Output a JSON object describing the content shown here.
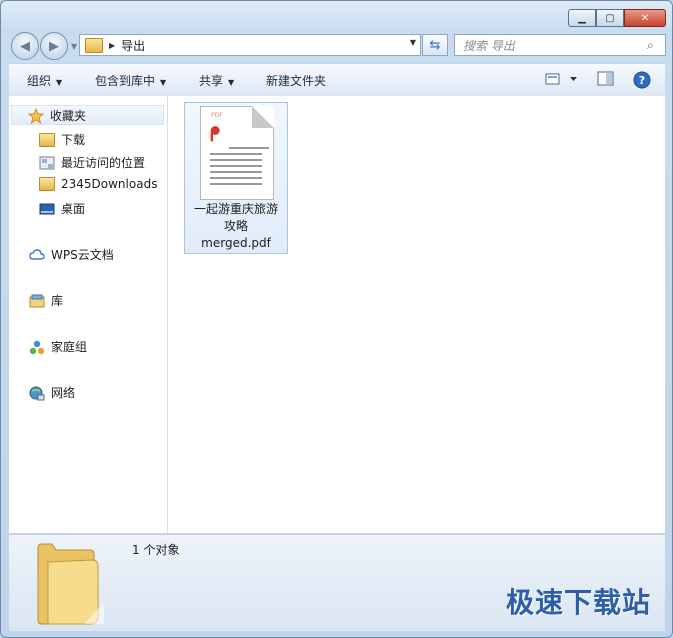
{
  "address": {
    "path": "导出"
  },
  "search": {
    "placeholder": "搜索 导出"
  },
  "toolbar": {
    "organize": "组织",
    "include_library": "包含到库中",
    "share": "共享",
    "new_folder": "新建文件夹"
  },
  "nav": {
    "favorites": "收藏夹",
    "downloads": "下载",
    "recent": "最近访问的位置",
    "downloads2345": "2345Downloads",
    "desktop": "桌面",
    "wps": "WPS云文档",
    "library": "库",
    "homegroup": "家庭组",
    "network": "网络"
  },
  "file": {
    "tag": "PDF",
    "name_line1": "一起游重庆旅游",
    "name_line2": "攻略",
    "name_line3": "merged.pdf"
  },
  "status": {
    "count": "1 个对象"
  },
  "watermark": "极速下载站",
  "colors": {
    "accent": "#2d5fa8",
    "pdf_red": "#d43a2c",
    "folder": "#e6b94a"
  }
}
